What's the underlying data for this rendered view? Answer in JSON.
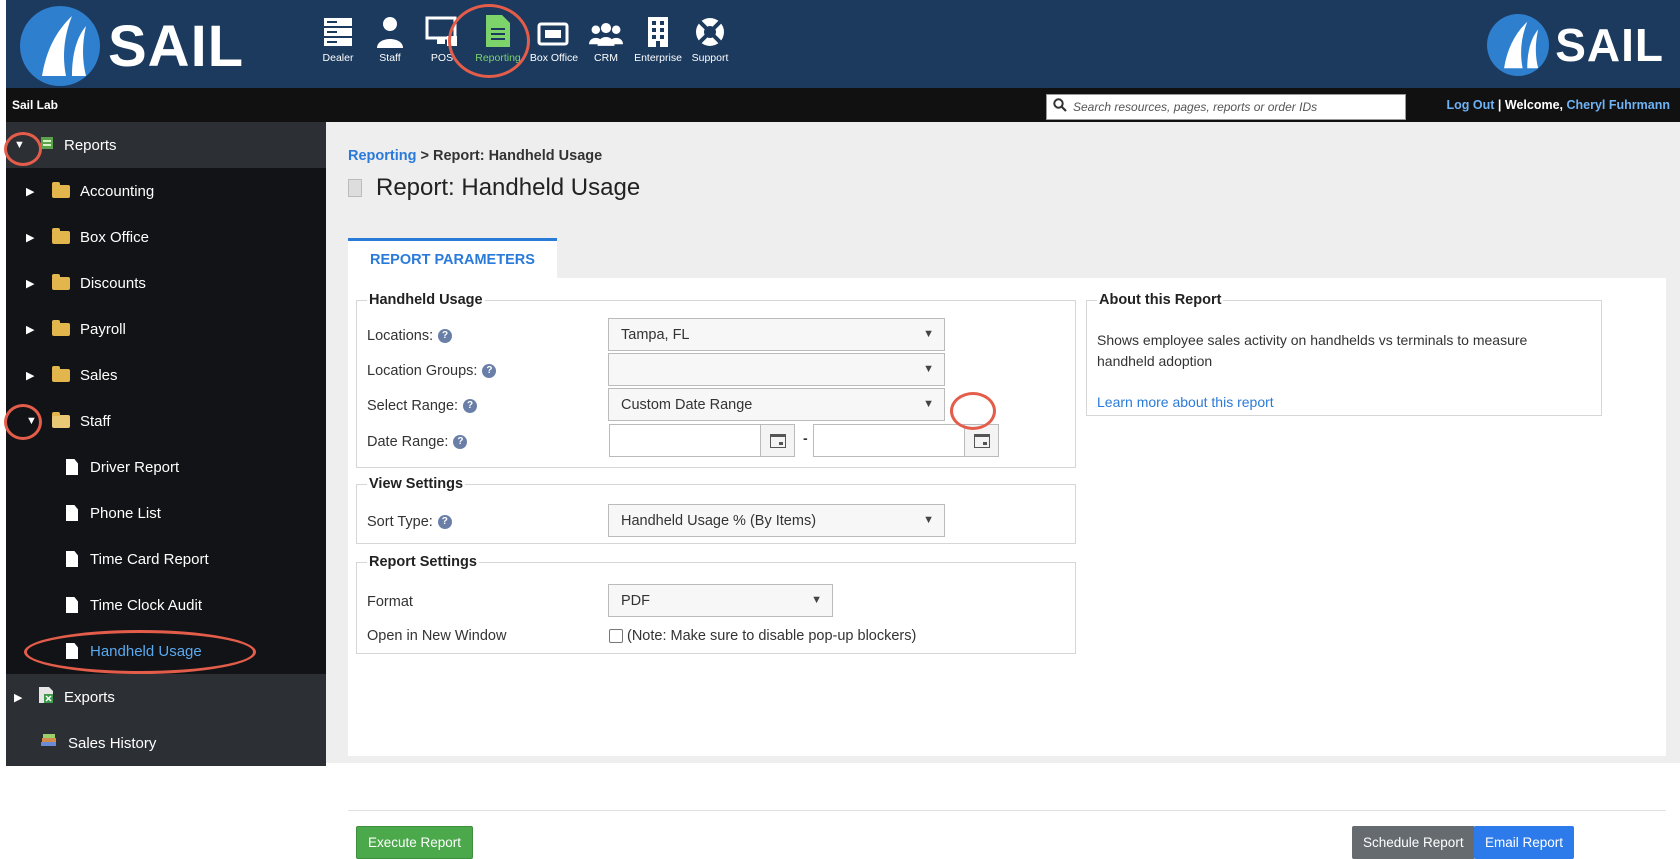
{
  "header": {
    "brand": "SAIL",
    "modules": [
      {
        "label": "Dealer",
        "icon": "server-icon"
      },
      {
        "label": "Staff",
        "icon": "person-icon"
      },
      {
        "label": "POS",
        "icon": "monitor-icon"
      },
      {
        "label": "Reporting",
        "icon": "report-doc-icon"
      },
      {
        "label": "Box Office",
        "icon": "ticket-icon"
      },
      {
        "label": "CRM",
        "icon": "group-icon"
      },
      {
        "label": "Enterprise",
        "icon": "building-icon"
      },
      {
        "label": "Support",
        "icon": "lifebuoy-icon"
      }
    ],
    "active_color": "#7cd46a",
    "bg_color": "#1b3a5e"
  },
  "subbar": {
    "env_name": "Sail Lab",
    "search_placeholder": "Search resources, pages, reports or order IDs",
    "logout": "Log Out",
    "separator": " | ",
    "welcome": "Welcome, ",
    "user_name": "Cheryl Fuhrmann"
  },
  "sidebar": {
    "root": {
      "label": "Reports",
      "expanded": true
    },
    "items": [
      {
        "label": "Accounting",
        "type": "folder",
        "expanded": false
      },
      {
        "label": "Box Office",
        "type": "folder",
        "expanded": false
      },
      {
        "label": "Discounts",
        "type": "folder",
        "expanded": false
      },
      {
        "label": "Payroll",
        "type": "folder",
        "expanded": false
      },
      {
        "label": "Sales",
        "type": "folder",
        "expanded": false
      },
      {
        "label": "Staff",
        "type": "folder",
        "expanded": true
      }
    ],
    "staff_children": [
      {
        "label": "Driver Report"
      },
      {
        "label": "Phone List"
      },
      {
        "label": "Time Card Report"
      },
      {
        "label": "Time Clock Audit"
      },
      {
        "label": "Handheld Usage",
        "current": true
      }
    ],
    "bottom_items": [
      {
        "label": "Exports"
      },
      {
        "label": "Sales History"
      }
    ]
  },
  "breadcrumb": {
    "link": "Reporting",
    "current": " > Report: Handheld Usage"
  },
  "page_title": "Report: Handheld Usage",
  "tabs": [
    {
      "label": "REPORT PARAMETERS",
      "active": true
    }
  ],
  "handheld_usage": {
    "legend": "Handheld Usage",
    "locations_label": "Locations:",
    "locations_value": "Tampa, FL",
    "location_groups_label": "Location Groups:",
    "location_groups_value": "",
    "select_range_label": "Select Range:",
    "select_range_value": "Custom Date Range",
    "date_range_label": "Date Range:",
    "date_start": "",
    "date_end": "",
    "date_separator": "-"
  },
  "view_settings": {
    "legend": "View Settings",
    "sort_type_label": "Sort Type:",
    "sort_type_value": "Handheld Usage % (By Items)"
  },
  "report_settings": {
    "legend": "Report Settings",
    "format_label": "Format",
    "format_value": "PDF",
    "new_window_label": "Open in New Window",
    "new_window_note": "(Note: Make sure to disable pop-up blockers)",
    "new_window_checked": false
  },
  "about": {
    "legend": "About this Report",
    "description": "Shows employee sales activity on handhelds vs terminals to measure handheld adoption",
    "link": "Learn more about this report"
  },
  "buttons": {
    "execute": "Execute Report",
    "schedule": "Schedule Report",
    "email": "Email Report"
  },
  "colors": {
    "link_blue": "#2a7ad9",
    "execute_green": "#4ba84b",
    "email_blue": "#2d7bea",
    "annotation_red": "#e35d4a"
  }
}
